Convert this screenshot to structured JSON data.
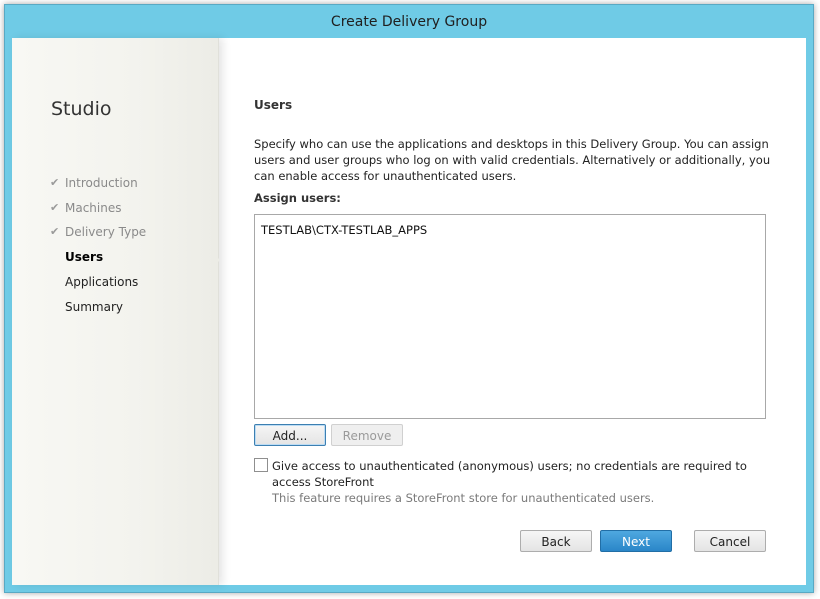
{
  "window": {
    "title": "Create Delivery Group"
  },
  "sidebar": {
    "app_name": "Studio",
    "steps": [
      {
        "label": "Introduction",
        "state": "completed"
      },
      {
        "label": "Machines",
        "state": "completed"
      },
      {
        "label": "Delivery Type",
        "state": "completed"
      },
      {
        "label": "Users",
        "state": "current"
      },
      {
        "label": "Applications",
        "state": "pending"
      },
      {
        "label": "Summary",
        "state": "pending"
      }
    ]
  },
  "main": {
    "heading": "Users",
    "description": "Specify who can use the applications and desktops in this Delivery Group. You can assign users and user groups who log on with valid credentials. Alternatively or additionally, you can enable access for unauthenticated users.",
    "assign_label": "Assign users:",
    "users": [
      "TESTLAB\\CTX-TESTLAB_APPS"
    ],
    "add_label": "Add...",
    "remove_label": "Remove",
    "unauth_checkbox": {
      "checked": false,
      "label": "Give access to unauthenticated (anonymous) users; no credentials are required to access StoreFront",
      "hint": "This feature requires a StoreFront store for unauthenticated users."
    }
  },
  "footer": {
    "back_label": "Back",
    "next_label": "Next",
    "cancel_label": "Cancel"
  },
  "icons": {
    "completed_step": "checkmark-icon"
  },
  "colors": {
    "titlebar": "#6fcbe6",
    "primary_button": "#2a86c8"
  }
}
